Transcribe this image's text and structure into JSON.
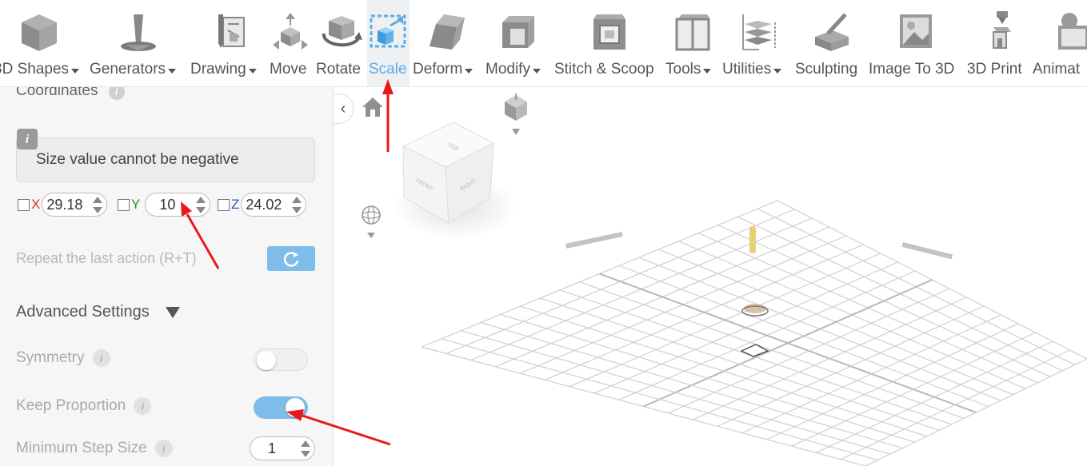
{
  "toolbar": {
    "items": [
      {
        "label": "3D Shapes",
        "dropdown": true
      },
      {
        "label": "Generators",
        "dropdown": true
      },
      {
        "label": "Drawing",
        "dropdown": true
      },
      {
        "label": "Move",
        "dropdown": false
      },
      {
        "label": "Rotate",
        "dropdown": false
      },
      {
        "label": "Scale",
        "dropdown": false,
        "active": true
      },
      {
        "label": "Deform",
        "dropdown": true
      },
      {
        "label": "Modify",
        "dropdown": true
      },
      {
        "label": "Stitch & Scoop",
        "dropdown": false
      },
      {
        "label": "Tools",
        "dropdown": true
      },
      {
        "label": "Utilities",
        "dropdown": true
      },
      {
        "label": "Sculpting",
        "dropdown": false
      },
      {
        "label": "Image To 3D",
        "dropdown": false
      },
      {
        "label": "3D Print",
        "dropdown": false
      },
      {
        "label": "Animat",
        "dropdown": false
      }
    ],
    "active_color": "#5aaee6"
  },
  "panel": {
    "coordinates_title": "Coordinates",
    "notice": "Size value cannot be negative",
    "axes": [
      {
        "axis": "X",
        "value": "29.18",
        "color": "#d9342b",
        "checked": false
      },
      {
        "axis": "Y",
        "value": "10",
        "color": "#2e8b2e",
        "checked": false
      },
      {
        "axis": "Z",
        "value": "24.02",
        "color": "#2f4fd0",
        "checked": false
      }
    ],
    "repeat_label": "Repeat the last action (R+T)",
    "advanced_title": "Advanced Settings",
    "symmetry": {
      "label": "Symmetry",
      "on": false
    },
    "keep_proportion": {
      "label": "Keep Proportion",
      "on": true
    },
    "min_step": {
      "label": "Minimum Step Size",
      "value": "1"
    }
  },
  "viewcube": {
    "top": "TOP",
    "front": "FRONT",
    "right": "RIGHT"
  },
  "annotation_color": "#e8191c"
}
